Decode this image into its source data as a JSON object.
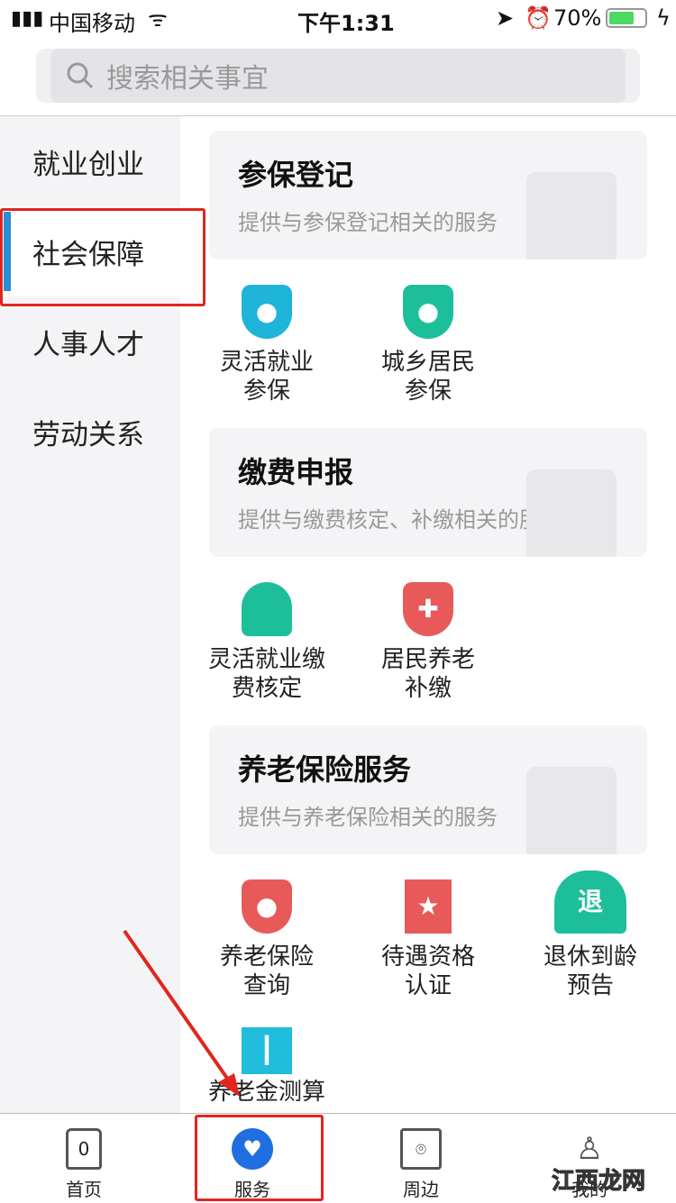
{
  "status": {
    "carrier": "中国移动",
    "time": "下午1:31",
    "battery": "70%",
    "battery_level": 0.7
  },
  "search": {
    "placeholder": "搜索相关事宜"
  },
  "sidebar": {
    "items": [
      {
        "label": "就业创业"
      },
      {
        "label": "社会保障",
        "active": true
      },
      {
        "label": "人事人才"
      },
      {
        "label": "劳动关系"
      }
    ]
  },
  "sections": [
    {
      "title": "参保登记",
      "subtitle": "提供与参保登记相关的服务",
      "items": [
        {
          "label": "灵活就业\n参保",
          "icon": "shield-person-icon",
          "color": "#1fb4d9"
        },
        {
          "label": "城乡居民\n参保",
          "icon": "shield-person-icon",
          "color": "#1dbf9a"
        }
      ]
    },
    {
      "title": "缴费申报",
      "subtitle": "提供与缴费核定、补缴相关的服务",
      "items": [
        {
          "label": "灵活就业缴\n费核定",
          "icon": "worker-icon",
          "color": "#1dbf9a"
        },
        {
          "label": "居民养老\n补缴",
          "icon": "shield-plus-icon",
          "color": "#e85a5a"
        }
      ]
    },
    {
      "title": "养老保险服务",
      "subtitle": "提供与养老保险相关的服务",
      "items": [
        {
          "label": "养老保险\n查询",
          "icon": "shield-person-icon",
          "color": "#e85a5a"
        },
        {
          "label": "待遇资格\n认证",
          "icon": "star-badge-icon",
          "color": "#e85a5a"
        },
        {
          "label": "退休到龄\n预告",
          "icon": "bell-icon",
          "color": "#1dbf9a",
          "glyph": "退"
        },
        {
          "label": "养老金测算",
          "icon": "bar-chart-icon",
          "color": "#1fbddb"
        }
      ]
    }
  ],
  "tabbar": {
    "items": [
      {
        "label": "首页",
        "icon": "home-icon"
      },
      {
        "label": "服务",
        "icon": "heart-icon",
        "active": true,
        "color": "#1f6fe0"
      },
      {
        "label": "周边",
        "icon": "map-icon"
      },
      {
        "label": "我的",
        "icon": "user-icon"
      }
    ]
  },
  "watermark": "江西龙网"
}
